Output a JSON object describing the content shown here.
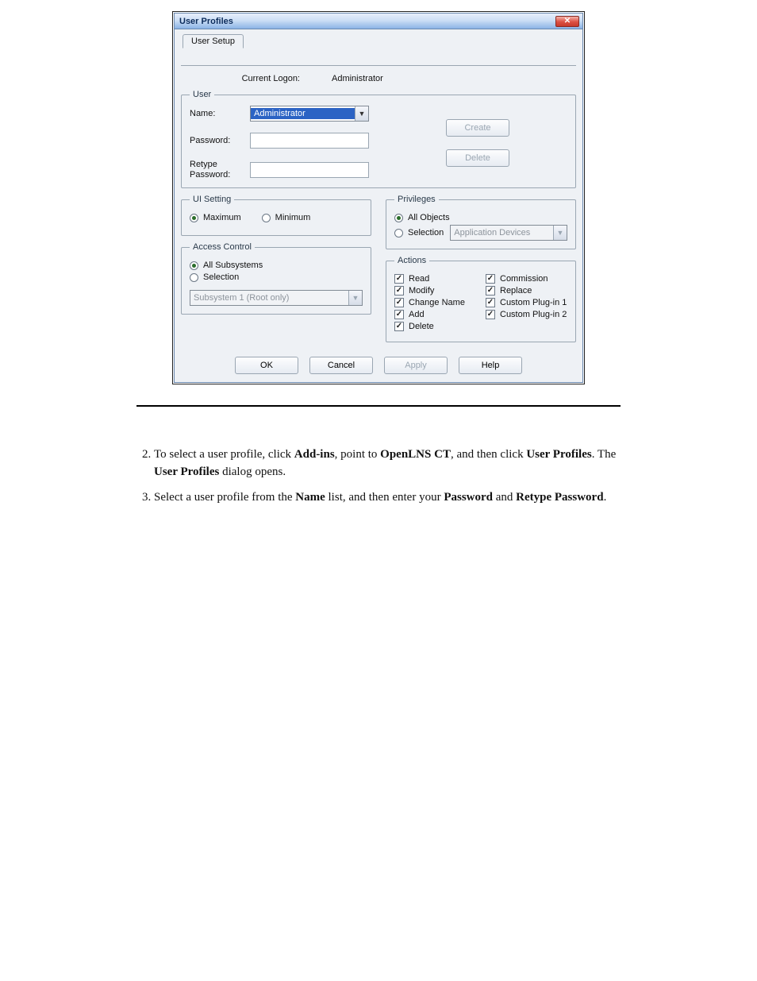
{
  "dialog": {
    "title": "User Profiles",
    "tab": "User Setup",
    "current_logon_label": "Current Logon:",
    "current_logon_value": "Administrator",
    "user_group": {
      "legend": "User",
      "name_label": "Name:",
      "name_value": "Administrator",
      "password_label": "Password:",
      "password_value": "",
      "retype_label": "Retype Password:",
      "retype_value": "",
      "create_btn": "Create",
      "delete_btn": "Delete"
    },
    "ui_setting": {
      "legend": "UI Setting",
      "maximum": "Maximum",
      "minimum": "Minimum",
      "selected": "maximum"
    },
    "access_control": {
      "legend": "Access Control",
      "all": "All Subsystems",
      "selection": "Selection",
      "selected": "all",
      "dropdown_value": "Subsystem 1 (Root only)"
    },
    "privileges": {
      "legend": "Privileges",
      "all_objects": "All Objects",
      "selection": "Selection",
      "selected": "all_objects",
      "dropdown_value": "Application Devices"
    },
    "actions": {
      "legend": "Actions",
      "items_left": [
        "Read",
        "Modify",
        "Change Name",
        "Add",
        "Delete"
      ],
      "items_right": [
        "Commission",
        "Replace",
        "Custom Plug-in 1",
        "Custom Plug-in 2"
      ]
    },
    "buttons": {
      "ok": "OK",
      "cancel": "Cancel",
      "apply": "Apply",
      "help": "Help"
    },
    "close": "✕"
  },
  "doc": {
    "step2_pre": "To select a user profile, click ",
    "step2_b1": "Add-ins",
    "step2_mid1": ", point to ",
    "step2_b2": "OpenLNS CT",
    "step2_mid2": ", and then click ",
    "step2_b3": "User Profiles",
    "step2_mid3": ". The ",
    "step2_b4": "User Profiles",
    "step2_end": " dialog opens.",
    "step3_pre": "Select a user profile from the ",
    "step3_b1": "Name",
    "step3_mid1": " list, and then enter your ",
    "step3_b2": "Password",
    "step3_mid2": " and ",
    "step3_b3": "Retype Password",
    "step3_end": "."
  }
}
